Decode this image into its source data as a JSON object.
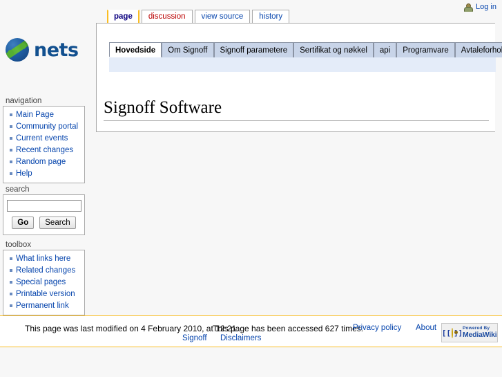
{
  "personal": {
    "login_label": "Log in",
    "user_icon": "user-avatar-icon"
  },
  "namespace_tabs": [
    {
      "label": "page",
      "state": "selected"
    },
    {
      "label": "discussion",
      "state": "new"
    },
    {
      "label": "view source",
      "state": "normal"
    },
    {
      "label": "history",
      "state": "normal"
    }
  ],
  "logo": {
    "wordmark": "nets",
    "icon": "nets-globe-icon"
  },
  "content_tabs": [
    {
      "label": "Hovedside",
      "active": true
    },
    {
      "label": "Om Signoff",
      "active": false
    },
    {
      "label": "Signoff parametere",
      "active": false
    },
    {
      "label": "Sertifikat og nøkkel",
      "active": false
    },
    {
      "label": "api",
      "active": false
    },
    {
      "label": "Programvare",
      "active": false
    },
    {
      "label": "Avtaleforhold",
      "active": false
    }
  ],
  "page": {
    "title": "Signoff Software",
    "body": ""
  },
  "sidebar": {
    "navigation": {
      "heading": "navigation",
      "items": [
        {
          "label": "Main Page"
        },
        {
          "label": "Community portal"
        },
        {
          "label": "Current events"
        },
        {
          "label": "Recent changes"
        },
        {
          "label": "Random page"
        },
        {
          "label": "Help"
        }
      ]
    },
    "search": {
      "heading": "search",
      "input_value": "",
      "input_placeholder": "",
      "go_label": "Go",
      "search_label": "Search"
    },
    "toolbox": {
      "heading": "toolbox",
      "items": [
        {
          "label": "What links here"
        },
        {
          "label": "Related changes"
        },
        {
          "label": "Special pages"
        },
        {
          "label": "Printable version"
        },
        {
          "label": "Permanent link"
        }
      ]
    }
  },
  "footer": {
    "lastmod": "This page was last modified on 4 February 2010, at 12:21.",
    "viewcount": "This page has been accessed 627 times.",
    "privacy": "Privacy policy",
    "about": "About",
    "copyright": "Signoff",
    "disclaimer": "Disclaimers",
    "poweredby": {
      "bracket_left": "[[",
      "bracket_right": "]]",
      "line1": "Powered By",
      "line2": "MediaWiki"
    }
  },
  "colors": {
    "link": "#0645ad",
    "link_new": "#ba0000",
    "tab_accent": "#fabd23",
    "tab_inactive_bg": "#c8d4e8",
    "tab_underbar_bg": "#e4ecf9",
    "brand_blue": "#12508f",
    "brand_green": "#55ae33"
  }
}
